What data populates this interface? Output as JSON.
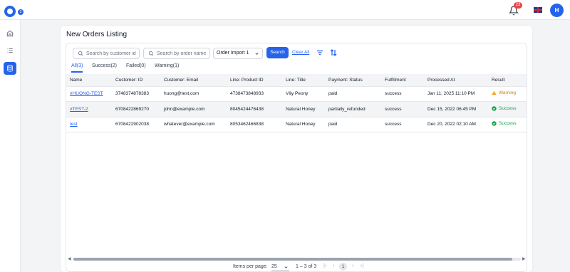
{
  "header": {
    "logo_badge": "2",
    "notification_count": "23",
    "avatar_initial": "H"
  },
  "page": {
    "title": "New Orders Listing"
  },
  "filters": {
    "customer_placeholder": "Search by customer id",
    "order_placeholder": "Search by order name",
    "import_select": "Order Import 1",
    "search_label": "Search",
    "clear_label": "Clear All"
  },
  "tabs": [
    {
      "label": "All(3)"
    },
    {
      "label": "Success(2)"
    },
    {
      "label": "Failed(0)"
    },
    {
      "label": "Warning(1)"
    }
  ],
  "table": {
    "columns": [
      "Name",
      "Customer: ID",
      "Customer: Email",
      "Line: Product ID",
      "Line: Title",
      "Payment: Status",
      "Fulfillment",
      "Processed At",
      "Result"
    ],
    "rows": [
      {
        "name": "#HUONG-TEST",
        "customer_id": "3748374878383",
        "email": "huong@test.com",
        "product_id": "4738473848933",
        "title": "Vây Peony",
        "payment": "paid",
        "fulfillment": "success",
        "processed": "Jan 11, 2025 11:10 PM",
        "result": "Warning",
        "result_type": "warning"
      },
      {
        "name": "#TEST-2",
        "customer_id": "6708422869270",
        "email": "john@example.com",
        "product_id": "8045424476438",
        "title": "Natural Honey",
        "payment": "partially_refunded",
        "fulfillment": "success",
        "processed": "Dec 15, 2022 06:45 PM",
        "result": "Success",
        "result_type": "success"
      },
      {
        "name": "test",
        "customer_id": "6708422902038",
        "email": "whatever@example.com",
        "product_id": "8053462466838",
        "title": "Natural Honey",
        "payment": "paid",
        "fulfillment": "success",
        "processed": "Dec 20, 2022 02:10 AM",
        "result": "Success",
        "result_type": "success"
      }
    ]
  },
  "pagination": {
    "items_per_page_label": "Items per page:",
    "page_size": "25",
    "range": "1 – 3 of 3",
    "current_page": "1"
  },
  "colors": {
    "accent": "#2563eb",
    "success": "#16a34a",
    "warning": "#d97706",
    "alert": "#ef4444"
  }
}
